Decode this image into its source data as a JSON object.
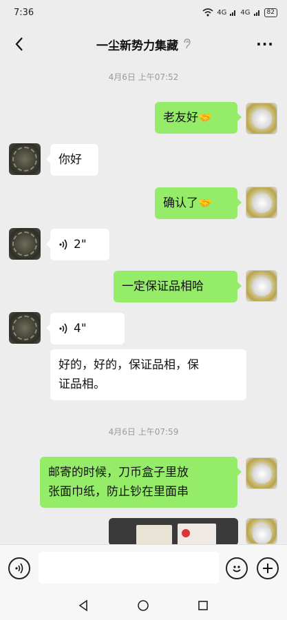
{
  "status": {
    "time": "7:36",
    "network1": "4G",
    "network2": "4G",
    "battery": "82"
  },
  "header": {
    "title": "一尘新势力集藏",
    "back_icon": "chevron-left-icon",
    "more_label": "···",
    "mute_icon": "ear-off-icon"
  },
  "timestamps": [
    "4月6日 上午07:52",
    "4月6日 上午07:59"
  ],
  "messages": [
    {
      "from": "self",
      "text": "老友好",
      "emoji": "🤝"
    },
    {
      "from": "other",
      "text": "你好"
    },
    {
      "from": "self",
      "text": "确认了",
      "emoji": "🤝"
    },
    {
      "from": "other",
      "type": "voice",
      "duration": "2\""
    },
    {
      "from": "self",
      "text": "一定保证品相哈"
    },
    {
      "from": "other",
      "type": "voice",
      "duration": "4\""
    },
    {
      "from": "other",
      "text_line1": "好的，好的，保证品相，保",
      "text_line2": "证品相。"
    },
    {
      "from": "self",
      "text_line1": "邮寄的时候，刀币盒子里放",
      "text_line2": "张面巾纸，防止钞在里面串"
    },
    {
      "from": "self",
      "type": "image"
    }
  ],
  "input": {
    "placeholder": "",
    "voice_icon": "voice-toggle-icon",
    "emoji_icon": "emoji-icon",
    "plus_icon": "plus-icon"
  },
  "system_nav": {
    "back": "back-triangle-icon",
    "home": "home-circle-icon",
    "recents": "recents-square-icon"
  }
}
